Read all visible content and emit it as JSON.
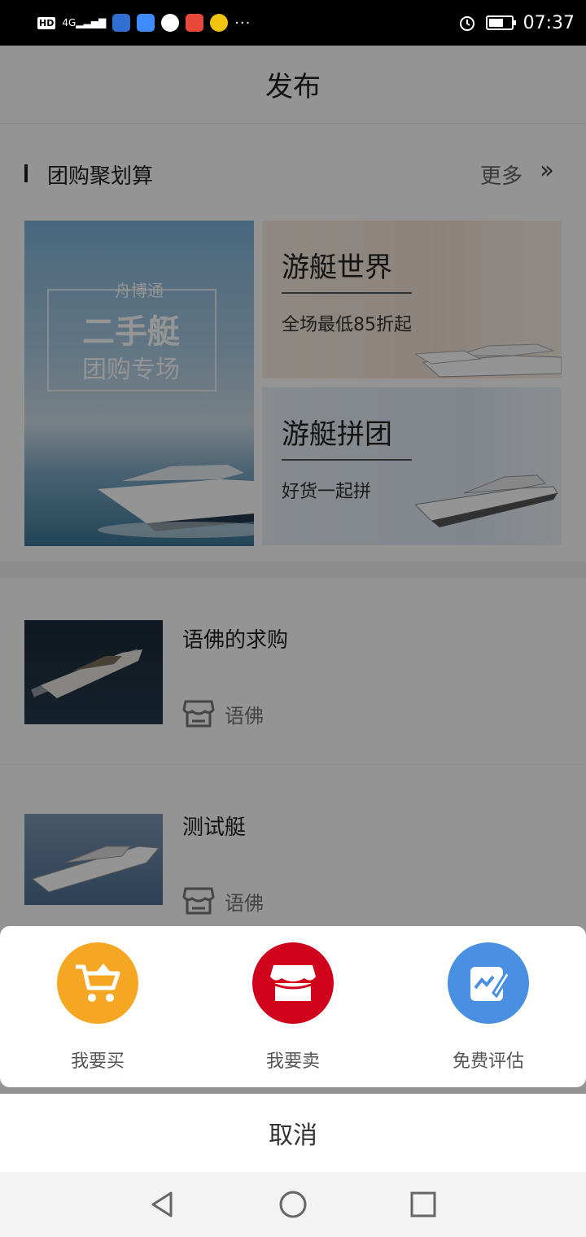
{
  "status_bar": {
    "left_labels": [
      "HD",
      "4G"
    ],
    "time": "07:37",
    "battery_level": 0.65,
    "more_dots": "···"
  },
  "nav": {
    "title": "发布"
  },
  "group_buy": {
    "title": "团购聚划算",
    "more": "更多",
    "banner": {
      "brand": "舟博通",
      "title": "二手艇",
      "subtitle": "团购专场"
    },
    "cards": [
      {
        "title": "游艇世界",
        "subtitle": "全场最低85折起"
      },
      {
        "title": "游艇拼团",
        "subtitle": "好货一起拼"
      }
    ]
  },
  "listings": [
    {
      "title": "语佛的求购",
      "shop": "语佛"
    },
    {
      "title": "测试艇",
      "shop": "语佛"
    }
  ],
  "sheet": {
    "actions": [
      {
        "label": "我要买",
        "icon": "cart-icon",
        "color": "#f5a623"
      },
      {
        "label": "我要卖",
        "icon": "shop-icon",
        "color": "#d0021b"
      },
      {
        "label": "免费评估",
        "icon": "edit-chart-icon",
        "color": "#4a90e2"
      }
    ],
    "cancel": "取消"
  },
  "system_nav": [
    "back-icon",
    "home-icon",
    "recents-icon"
  ]
}
